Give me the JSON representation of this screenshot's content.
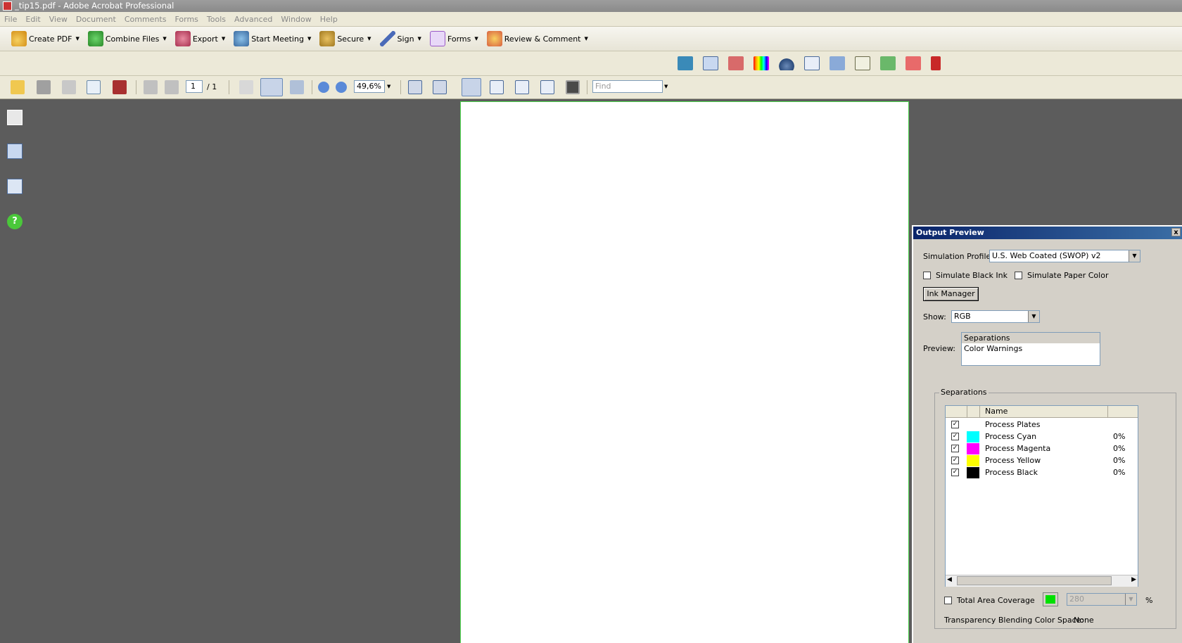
{
  "window": {
    "title": "_tip15.pdf - Adobe Acrobat Professional"
  },
  "menu": [
    "File",
    "Edit",
    "View",
    "Document",
    "Comments",
    "Forms",
    "Tools",
    "Advanced",
    "Window",
    "Help"
  ],
  "tasks": [
    {
      "label": "Create PDF",
      "color": "#e8a820"
    },
    {
      "label": "Combine Files",
      "color": "#3aa63a"
    },
    {
      "label": "Export",
      "color": "#c84a6a"
    },
    {
      "label": "Start Meeting",
      "color": "#3a7ab8"
    },
    {
      "label": "Secure",
      "color": "#b08a20"
    },
    {
      "label": "Sign",
      "color": "#4a6ab8"
    },
    {
      "label": "Forms",
      "color": "#9a5ac8"
    },
    {
      "label": "Review & Comment",
      "color": "#e8b030"
    }
  ],
  "nav": {
    "page_current": "1",
    "page_total": "/ 1",
    "zoom": "49,6%",
    "find_placeholder": "Find"
  },
  "output_preview": {
    "title": "Output Preview",
    "close": "x",
    "simulation_profile_label": "Simulation Profile:",
    "simulation_profile_value": "U.S. Web Coated (SWOP) v2",
    "simulate_black_ink": "Simulate Black Ink",
    "simulate_paper_color": "Simulate Paper Color",
    "ink_manager": "Ink Manager",
    "show_label": "Show:",
    "show_value": "RGB",
    "preview_label": "Preview:",
    "preview_options": [
      "Separations",
      "Color Warnings"
    ],
    "separations_title": "Separations",
    "table_header": "Name",
    "separations": [
      {
        "name": "Process Plates",
        "pct": "",
        "color": ""
      },
      {
        "name": "Process Cyan",
        "pct": "0%",
        "color": "#00ffff"
      },
      {
        "name": "Process Magenta",
        "pct": "0%",
        "color": "#ff00ff"
      },
      {
        "name": "Process Yellow",
        "pct": "0%",
        "color": "#ffff00"
      },
      {
        "name": "Process Black",
        "pct": "0%",
        "color": "#000000"
      }
    ],
    "total_area_coverage": "Total Area Coverage",
    "coverage_value": "280",
    "coverage_unit": "%",
    "coverage_swatch": "#00e000",
    "transparency_label": "Transparency Blending Color Space:",
    "transparency_value": "None"
  }
}
